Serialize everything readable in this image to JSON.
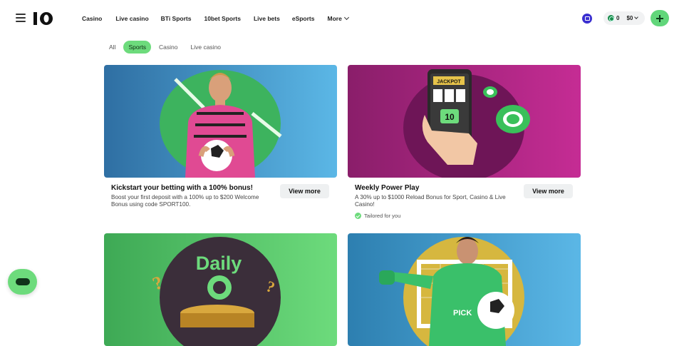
{
  "header": {
    "logo_text": "10",
    "nav": [
      "Casino",
      "Live casino",
      "BTi Sports",
      "10bet Sports",
      "Live bets",
      "eSports"
    ],
    "more_label": "More",
    "wallet": {
      "coins": "0",
      "balance": "$0"
    }
  },
  "filters": [
    {
      "label": "All",
      "active": false
    },
    {
      "label": "Sports",
      "active": true
    },
    {
      "label": "Casino",
      "active": false
    },
    {
      "label": "Live casino",
      "active": false
    }
  ],
  "cards": [
    {
      "title": "Kickstart your betting with a 100% bonus!",
      "desc": "Boost your first deposit with a 100% up to $200 Welcome Bonus using code SPORT100.",
      "button": "View more",
      "tag": ""
    },
    {
      "title": "Weekly Power Play",
      "desc": "A 30% up to $1000 Reload Bonus for Sport, Casino & Live Casino!",
      "button": "View more",
      "tag": "Tailored for you",
      "image_text": {
        "jackpot": "JACKPOT",
        "logo": "10"
      }
    },
    {
      "image_text": {
        "daily": "Daily"
      }
    },
    {
      "image_text": {
        "shirt": "PICK"
      }
    }
  ],
  "colors": {
    "accent_green": "#6ddb7c",
    "card1_bg": "#3a8fc4",
    "card2_bg": "#c12a8e",
    "card3_bg": "#4fc463",
    "card4_bg": "#3aa2d0"
  }
}
